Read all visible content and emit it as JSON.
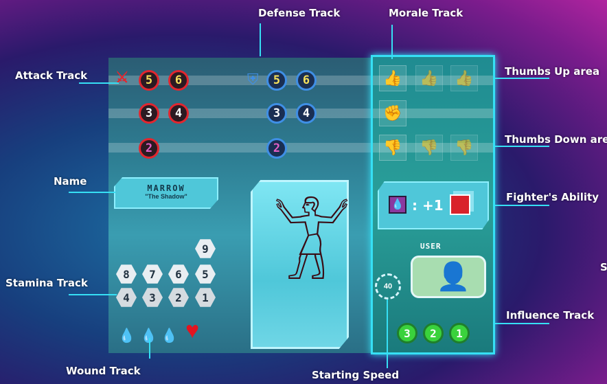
{
  "labels": {
    "attack_track": "Attack Track",
    "defense_track": "Defense Track",
    "morale_track": "Morale Track",
    "thumbs_up": "Thumbs Up area",
    "thumbs_down": "Thumbs Down area",
    "fighters_ability": "Fighter's Ability",
    "name": "Name",
    "stamina_track": "Stamina Track",
    "influence_track": "Influence Track",
    "wound_track": "Wound Track",
    "starting_speed": "Starting Speed",
    "edge_letter": "S"
  },
  "card": {
    "fighter_name": "MARROW",
    "fighter_nickname": "\"The Shadow\"",
    "attack_row1": [
      "5",
      "6"
    ],
    "attack_row2": [
      "3",
      "4"
    ],
    "attack_row3": [
      "2"
    ],
    "defense_row1": [
      "5",
      "6"
    ],
    "defense_row2": [
      "3",
      "4"
    ],
    "defense_row3": [
      "2"
    ],
    "stamina_top": "9",
    "stamina_row1": [
      "8",
      "7",
      "6",
      "5"
    ],
    "stamina_row2": [
      "4",
      "3",
      "2",
      "1"
    ],
    "ability_text": ": +1",
    "user_label": "USER",
    "speed_value": "40",
    "influence": [
      "3",
      "2",
      "1"
    ]
  },
  "colors": {
    "highlight": "#36e0f5",
    "attack": "#e2262f",
    "defense": "#3f8fe6",
    "influence": "#3ad23c"
  }
}
